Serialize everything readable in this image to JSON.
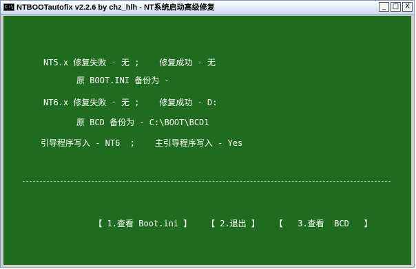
{
  "window": {
    "icon_text": "C:\\",
    "title": "NTBOOTautofix v2.2.6 by chz_hlh - NT系统启动高级修复",
    "min_label": "_",
    "max_label": "□",
    "close_label": "X"
  },
  "console": {
    "lines": [
      "NT5.x 修复失败 - 无 ;    修复成功 - 无",
      "原 BOOT.INI 备份为 -",
      "NT6.x 修复失败 - 无 ;    修复成功 - D:",
      "原 BCD 备份为 - C:\\BOOT\\BCD1",
      "引导程序写入 - NT6  ;    主引导程序写入 - Yes"
    ],
    "menu": {
      "option1": "【 1.查看 Boot.ini 】",
      "option2": "【 2.退出 】",
      "option3": "【   3.查看  BCD   】"
    }
  },
  "colors": {
    "console_bg": "#1f6b1f",
    "console_text": "#ffffff"
  }
}
